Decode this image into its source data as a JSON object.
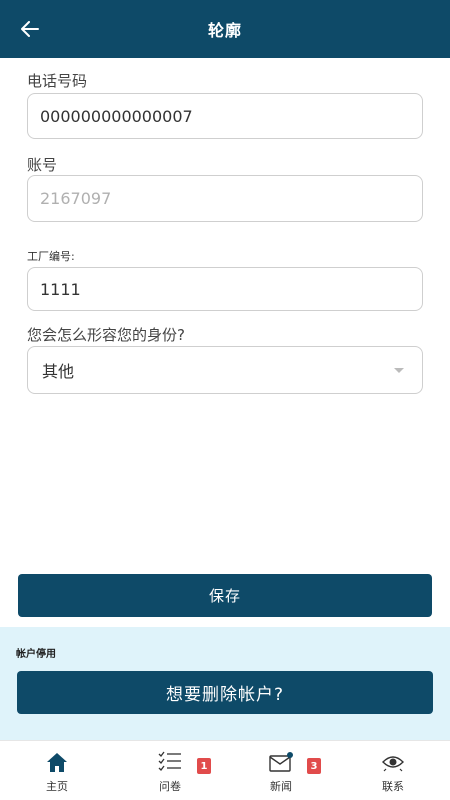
{
  "header": {
    "title": "轮廓",
    "back_icon": "arrow-left-icon"
  },
  "form": {
    "phone": {
      "label": "电话号码",
      "value": "000000000000007"
    },
    "account": {
      "label": "账号",
      "placeholder": "2167097"
    },
    "factory": {
      "label": "工厂编号:",
      "value": "1111"
    },
    "identity": {
      "label": "您会怎么形容您的身份?",
      "selected": "其他"
    }
  },
  "save_label": "保存",
  "deactivate": {
    "label": "帐户停用",
    "button_label": "想要删除帐户?"
  },
  "tabbar": {
    "items": [
      {
        "label": "主页",
        "icon": "home-icon"
      },
      {
        "label": "问卷",
        "icon": "checklist-icon",
        "badge": "1"
      },
      {
        "label": "新闻",
        "icon": "envelope-icon",
        "badge": "3"
      },
      {
        "label": "联系",
        "icon": "contact-eye-icon"
      }
    ]
  },
  "colors": {
    "primary": "#0e4a68",
    "badge": "#e14b4b",
    "deactivate_bg": "#dff3fa"
  }
}
